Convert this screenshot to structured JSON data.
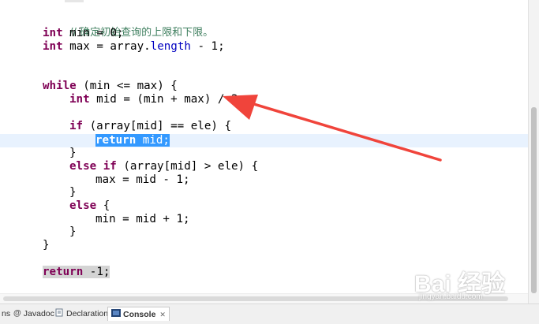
{
  "code": {
    "comment": "// 确定初始查询的上限和下限。",
    "line_min": {
      "kw": "int",
      "rest": " min = 0;"
    },
    "line_max": {
      "kw": "int",
      "pre": " max = array.",
      "field": "length",
      "post": " - 1;"
    },
    "line_while": {
      "kw": "while",
      "rest": " (min <= max) {"
    },
    "line_mid": {
      "kw": "int",
      "rest": " mid = (min + max) / 2;"
    },
    "line_if": {
      "kw": "if",
      "rest": " (array[mid] == ele) {"
    },
    "line_return_mid": {
      "kw": "return",
      "rest": " mid;"
    },
    "line_close1": "}",
    "line_elseif": {
      "kw1": "else",
      "kw2": "if",
      "rest": " (array[mid] > ele) {"
    },
    "line_max_assign": "max = mid - 1;",
    "line_close2": "}",
    "line_else": {
      "kw": "else",
      "rest": " {"
    },
    "line_min_assign": "min = mid + 1;",
    "line_close3": "}",
    "line_close4": "}",
    "line_return_neg": {
      "kw": "return",
      "rest": " -1;"
    }
  },
  "bottom_tabs": [
    {
      "label": "ns",
      "icon": "problems-icon"
    },
    {
      "label": "Javadoc",
      "icon": "javadoc-icon"
    },
    {
      "label": "Declaration",
      "icon": "declaration-icon"
    },
    {
      "label": "Console",
      "icon": "console-icon",
      "active": true
    }
  ],
  "watermark": {
    "text": "Bai 经验",
    "sub": "jingyan.baidu.com"
  },
  "colors": {
    "keyword": "#7f0055",
    "field": "#0000c0",
    "comment": "#3f7f5f",
    "selection": "#3399ff",
    "current_line": "#e8f2fe",
    "arrow": "#f0443b"
  }
}
